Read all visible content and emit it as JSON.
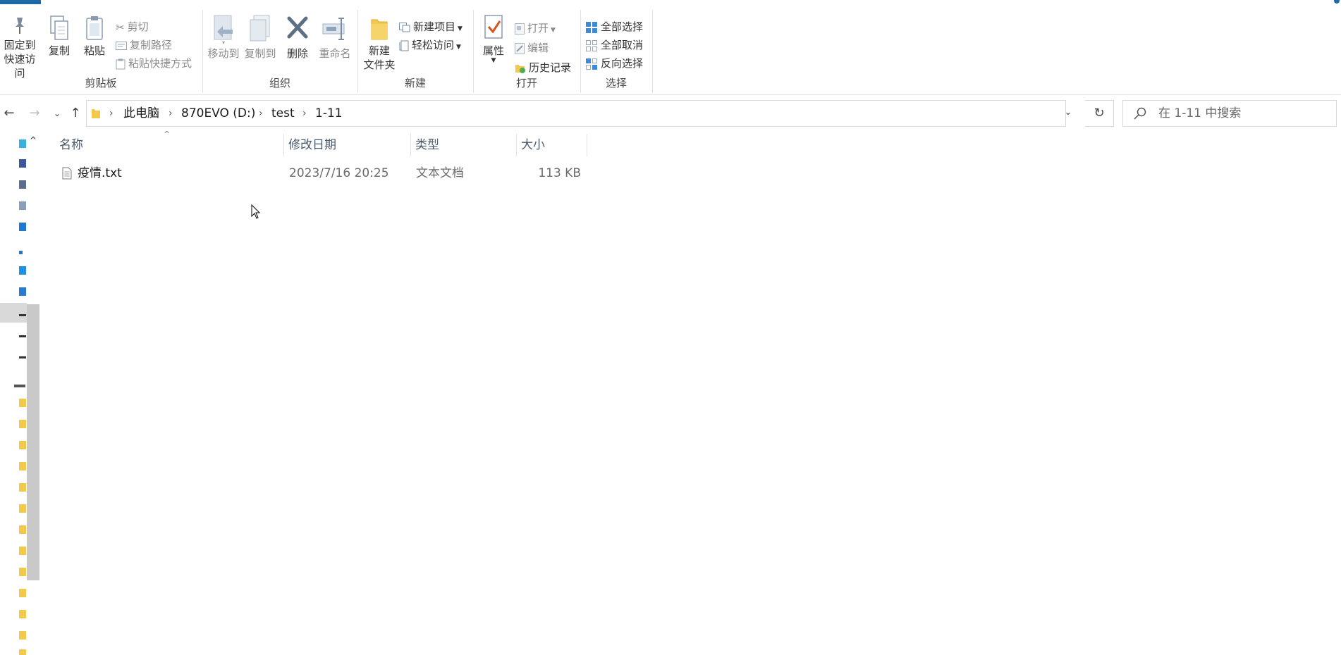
{
  "window": {
    "accent_color": "#1e6aa6"
  },
  "ribbon": {
    "clipboard": {
      "label": "剪贴板",
      "pin_line1": "固定到",
      "pin_line2": "快速访问",
      "copy": "复制",
      "paste": "粘贴",
      "cut": "剪切",
      "copy_path": "复制路径",
      "paste_shortcut": "粘贴快捷方式"
    },
    "organize": {
      "label": "组织",
      "move_to": "移动到",
      "copy_to": "复制到",
      "delete": "删除",
      "rename": "重命名"
    },
    "new": {
      "label": "新建",
      "new_folder_line1": "新建",
      "new_folder_line2": "文件夹",
      "new_item": "新建项目",
      "easy_access": "轻松访问"
    },
    "open": {
      "label": "打开",
      "properties": "属性",
      "open": "打开",
      "edit": "编辑",
      "history": "历史记录"
    },
    "select": {
      "label": "选择",
      "select_all": "全部选择",
      "select_none": "全部取消",
      "invert": "反向选择"
    }
  },
  "address": {
    "crumbs": [
      "此电脑",
      "870EVO (D:)",
      "test",
      "1-11"
    ],
    "search_placeholder": "在 1-11 中搜索"
  },
  "columns": {
    "name": "名称",
    "modified": "修改日期",
    "type": "类型",
    "size": "大小"
  },
  "files": [
    {
      "name": "疫情.txt",
      "modified": "2023/7/16 20:25",
      "type": "文本文档",
      "size": "113 KB",
      "icon": "text-file-icon"
    }
  ]
}
